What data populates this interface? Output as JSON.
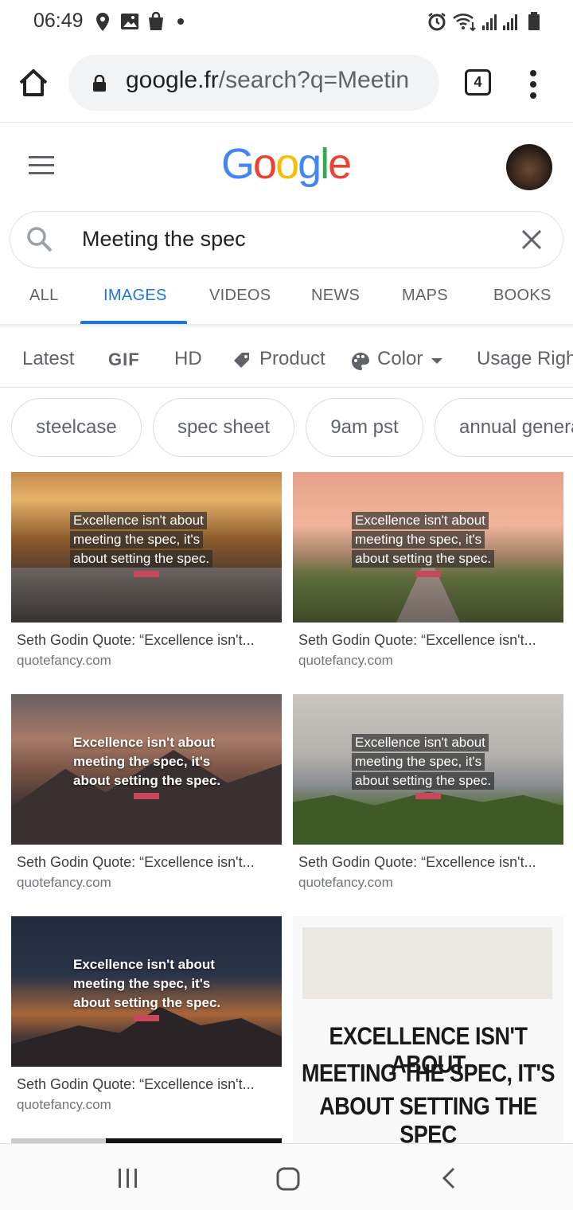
{
  "status_bar": {
    "time": "06:49",
    "icons": [
      "location-icon",
      "gallery-icon",
      "shopping-bag-icon",
      "dot-icon",
      "alarm-icon",
      "wifi-icon",
      "signal-icon",
      "signal-icon",
      "battery-icon"
    ]
  },
  "browser": {
    "url_host": "google.fr",
    "url_path": "/search?q=Meetin",
    "tab_count": "4"
  },
  "search": {
    "query": "Meeting the spec"
  },
  "logo": {
    "letters": [
      "G",
      "o",
      "o",
      "g",
      "l",
      "e"
    ],
    "colors": [
      "#4285F4",
      "#EA4335",
      "#FBBC05",
      "#4285F4",
      "#34A853",
      "#EA4335"
    ]
  },
  "tabs": [
    {
      "label": "ALL"
    },
    {
      "label": "IMAGES",
      "active": true
    },
    {
      "label": "VIDEOS"
    },
    {
      "label": "NEWS"
    },
    {
      "label": "MAPS"
    },
    {
      "label": "BOOKS"
    }
  ],
  "tools": {
    "latest": "Latest",
    "gif": "GIF",
    "hd": "HD",
    "product": "Product",
    "color": "Color",
    "usage_rights": "Usage Righ"
  },
  "chips": [
    "steelcase",
    "spec sheet",
    "9am pst",
    "annual genera"
  ],
  "results": [
    {
      "quote": [
        "Excellence isn't about",
        "meeting the spec, it's",
        "about setting the spec."
      ],
      "title": "Seth Godin Quote: “Excellence isn't...",
      "source": "quotefancy.com"
    },
    {
      "quote": [
        "Excellence isn't about",
        "meeting the spec, it's",
        "about setting the spec."
      ],
      "title": "Seth Godin Quote: “Excellence isn't...",
      "source": "quotefancy.com"
    },
    {
      "quote": [
        "Excellence isn't about",
        "meeting the spec, it's",
        "about setting the spec."
      ],
      "title": "Seth Godin Quote: “Excellence isn't...",
      "source": "quotefancy.com"
    },
    {
      "quote": [
        "Excellence isn't about",
        "meeting the spec, it's",
        "about setting the spec."
      ],
      "title": "Seth Godin Quote: “Excellence isn't...",
      "source": "quotefancy.com"
    },
    {
      "quote": [
        "Excellence isn't about",
        "meeting the spec, it's",
        "about setting the spec."
      ],
      "title": "Seth Godin Quote: “Excellence isn't...",
      "source": "quotefancy.com"
    }
  ],
  "big_quote": [
    "EXCELLENCE ISN'T ABOUT",
    "MEETING THE SPEC, IT'S",
    "ABOUT SETTING THE SPEC"
  ],
  "accent_color": "#1a73e8"
}
